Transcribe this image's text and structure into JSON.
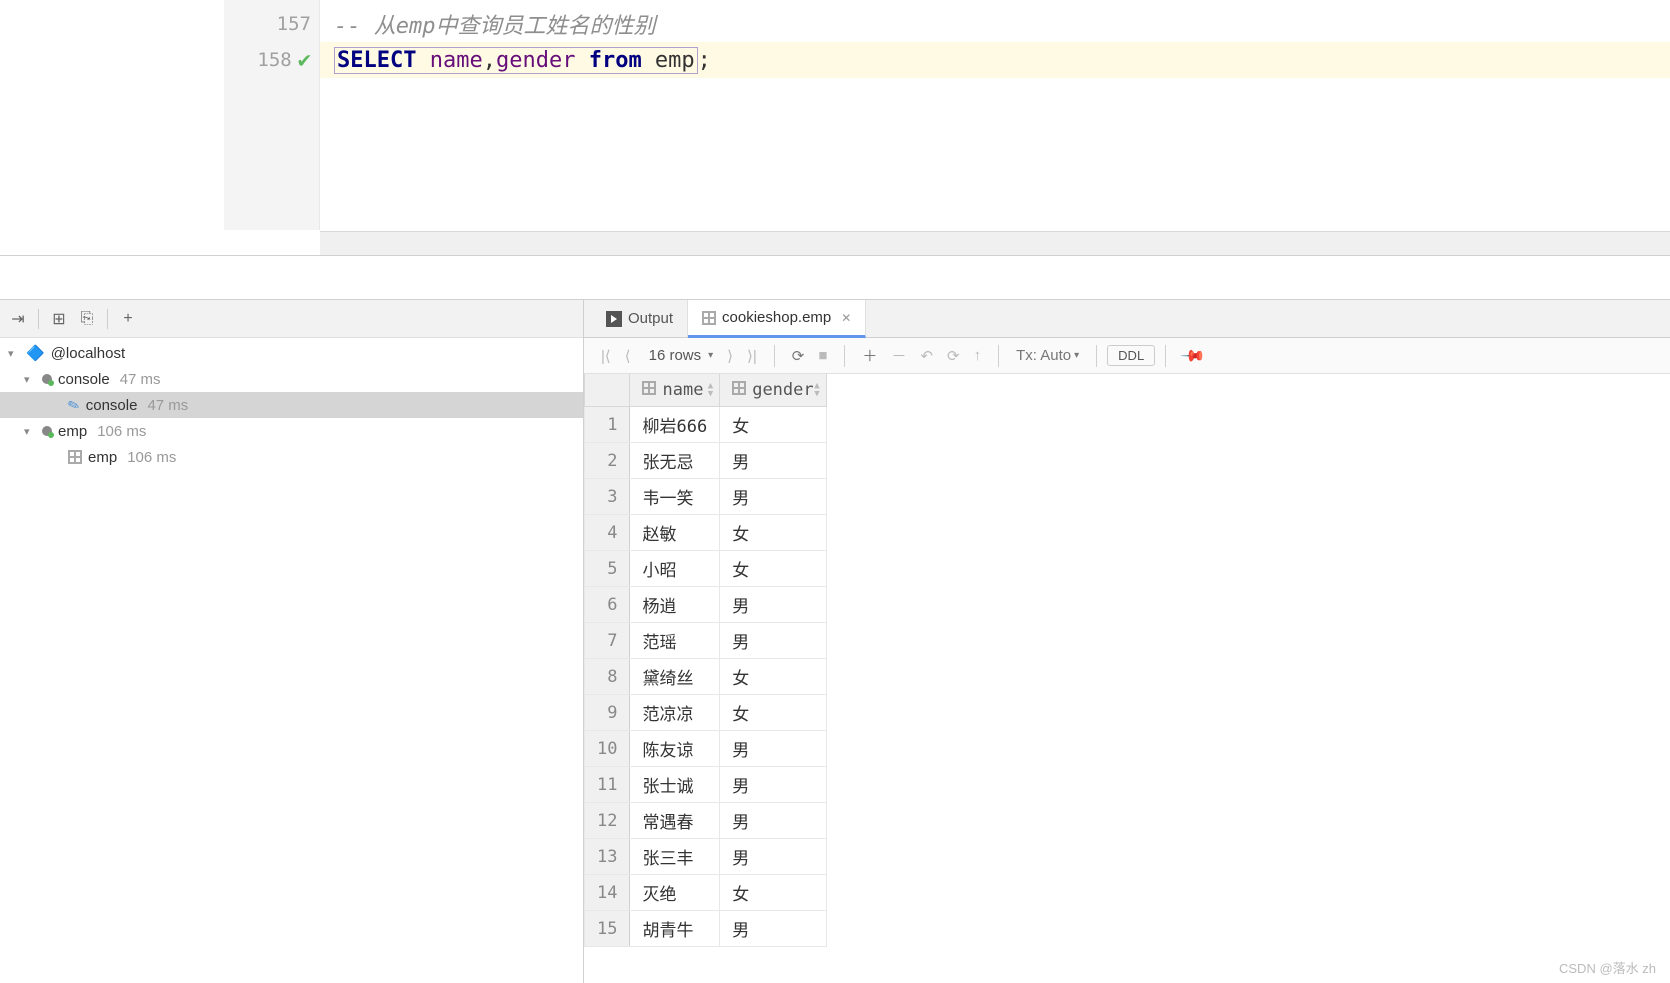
{
  "editor": {
    "lines": [
      {
        "num": "157",
        "executed": false,
        "tokens": [
          {
            "cls": "comment",
            "text": "-- 从emp中查询员工姓名的性别"
          }
        ]
      },
      {
        "num": "158",
        "executed": true,
        "highlighted": true,
        "boxed": true,
        "tokens": [
          {
            "cls": "kw",
            "text": "SELECT"
          },
          {
            "cls": "plain",
            "text": " "
          },
          {
            "cls": "ident",
            "text": "name"
          },
          {
            "cls": "plain",
            "text": ","
          },
          {
            "cls": "ident",
            "text": "gender"
          },
          {
            "cls": "plain",
            "text": " "
          },
          {
            "cls": "kw",
            "text": "from"
          },
          {
            "cls": "plain",
            "text": " emp"
          }
        ],
        "trailing": ";"
      }
    ]
  },
  "tree": {
    "root_label": "@localhost",
    "items": [
      {
        "level": 1,
        "arrow": "▾",
        "dot": true,
        "label": "console",
        "time": "47 ms"
      },
      {
        "level": 2,
        "arrow": "",
        "quill": true,
        "label": "console",
        "time": "47 ms",
        "selected": true
      },
      {
        "level": 1,
        "arrow": "▾",
        "dot": true,
        "label": "emp",
        "time": "106 ms"
      },
      {
        "level": 2,
        "arrow": "",
        "grid": true,
        "label": "emp",
        "time": "106 ms"
      }
    ]
  },
  "tabs": {
    "output_label": "Output",
    "active_label": "cookieshop.emp"
  },
  "toolbar": {
    "rows_label": "16 rows",
    "tx_label": "Tx: Auto",
    "ddl_label": "DDL"
  },
  "columns": [
    {
      "key": "name",
      "label": "name"
    },
    {
      "key": "gender",
      "label": "gender"
    }
  ],
  "rows": [
    {
      "n": "1",
      "name": "柳岩666",
      "gender": "女"
    },
    {
      "n": "2",
      "name": "张无忌",
      "gender": "男"
    },
    {
      "n": "3",
      "name": "韦一笑",
      "gender": "男"
    },
    {
      "n": "4",
      "name": "赵敏",
      "gender": "女"
    },
    {
      "n": "5",
      "name": "小昭",
      "gender": "女"
    },
    {
      "n": "6",
      "name": "杨逍",
      "gender": "男"
    },
    {
      "n": "7",
      "name": "范瑶",
      "gender": "男"
    },
    {
      "n": "8",
      "name": "黛绮丝",
      "gender": "女"
    },
    {
      "n": "9",
      "name": "范凉凉",
      "gender": "女"
    },
    {
      "n": "10",
      "name": "陈友谅",
      "gender": "男"
    },
    {
      "n": "11",
      "name": "张士诚",
      "gender": "男"
    },
    {
      "n": "12",
      "name": "常遇春",
      "gender": "男"
    },
    {
      "n": "13",
      "name": "张三丰",
      "gender": "男"
    },
    {
      "n": "14",
      "name": "灭绝",
      "gender": "女"
    },
    {
      "n": "15",
      "name": "胡青牛",
      "gender": "男"
    }
  ],
  "watermark": "CSDN @落水 zh"
}
